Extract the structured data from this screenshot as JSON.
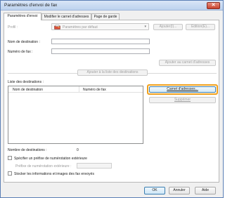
{
  "window": {
    "title": "Paramètres d'envoi de fax",
    "close_glyph": "✕"
  },
  "tabs": [
    {
      "label": "Paramètres d'envoi",
      "active": true
    },
    {
      "label": "Modifier le carnet d'adresses",
      "active": false
    },
    {
      "label": "Page de garde",
      "active": false
    }
  ],
  "profile": {
    "label": "Profil :",
    "selected": "Paramètres par défaut",
    "add_button": "Ajouter(I)...",
    "edit_button": "Edition(E)..."
  },
  "destination": {
    "name_label": "Nom de destination :",
    "name_value": "",
    "fax_label": "Numéro de fax :",
    "fax_value": "",
    "add_to_address_book_button": "Ajouter au carnet d'adresses",
    "add_to_list_button": "Ajouter à la liste des destinations"
  },
  "destinations_list": {
    "label": "Liste des destinations :",
    "columns": [
      "Nom de destination",
      "Numéro de fax"
    ],
    "rows": [],
    "address_book_button": "Carnet d'adresses...",
    "delete_button": "Supprimer",
    "count_label": "Nombre de destinations :",
    "count_value": "0"
  },
  "options": {
    "outside_prefix_checkbox": "Spécifier un préfixe de numérotation extérieure",
    "outside_prefix_checked": false,
    "outside_prefix_label": "Préfixe de numérotation extérieure :",
    "outside_prefix_value": "",
    "store_images_checkbox": "Stocker les informations et images des fax envoyés",
    "store_images_checked": false
  },
  "footer": {
    "ok": "OK",
    "cancel": "Annuler",
    "help": "Aide"
  },
  "colors": {
    "highlight": "#f0a01c",
    "titlebar": "#bcd2ee",
    "focus_border": "#3c7fb1"
  }
}
